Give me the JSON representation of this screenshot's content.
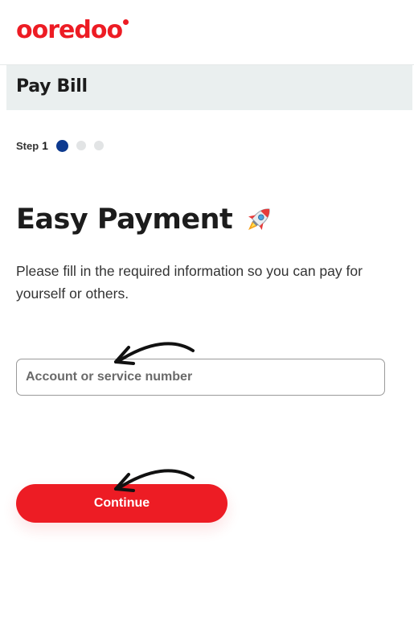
{
  "brand": {
    "logo_text": "ooredoo",
    "color": "#ed1c24"
  },
  "page": {
    "title": "Pay Bill"
  },
  "stepper": {
    "label": "Step",
    "number": "1",
    "total_steps": 3,
    "current_step": 1,
    "active_color": "#0d3a8f"
  },
  "main": {
    "heading": "Easy Payment",
    "heading_icon": "rocket-icon",
    "description": "Please fill in the required information so you can pay for yourself or others."
  },
  "form": {
    "account_field": {
      "placeholder": "Account or service number",
      "value": ""
    },
    "continue_label": "Continue"
  },
  "annotations": {
    "arrow_icon": "hand-drawn-arrow-icon"
  }
}
